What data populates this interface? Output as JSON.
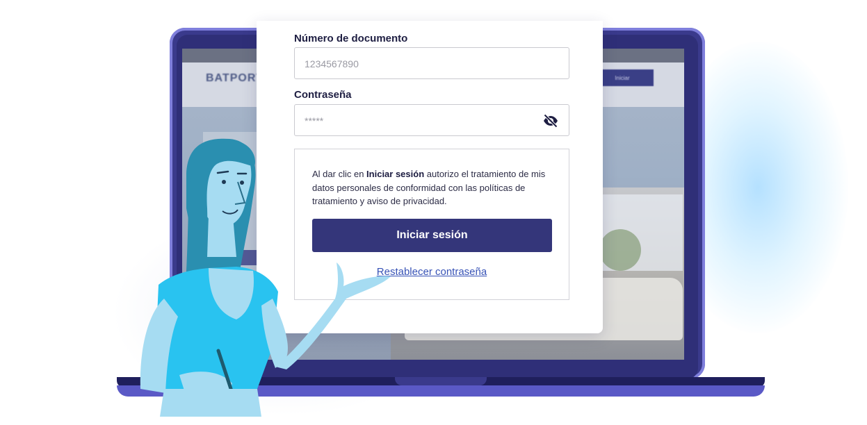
{
  "background_screen": {
    "brand": "BATPORT",
    "nav_button": "Iniciar"
  },
  "form": {
    "document_label": "Número de documento",
    "document_placeholder": "1234567890",
    "password_label": "Contraseña",
    "password_placeholder": "*****",
    "password_toggle_icon": "eye-slash-icon",
    "consent_prefix": "Al dar clic en ",
    "consent_bold": "Iniciar sesión",
    "consent_suffix": " autorizo el tratamiento de mis datos personales de conformidad con las políticas de tratamiento y aviso de privacidad.",
    "login_button": "Iniciar sesión",
    "reset_link": "Restablecer contraseña"
  },
  "colors": {
    "primary_button": "#34367a",
    "link": "#3752b6",
    "laptop": "#3a3a8c",
    "illustration_accent": "#29c3f0"
  }
}
